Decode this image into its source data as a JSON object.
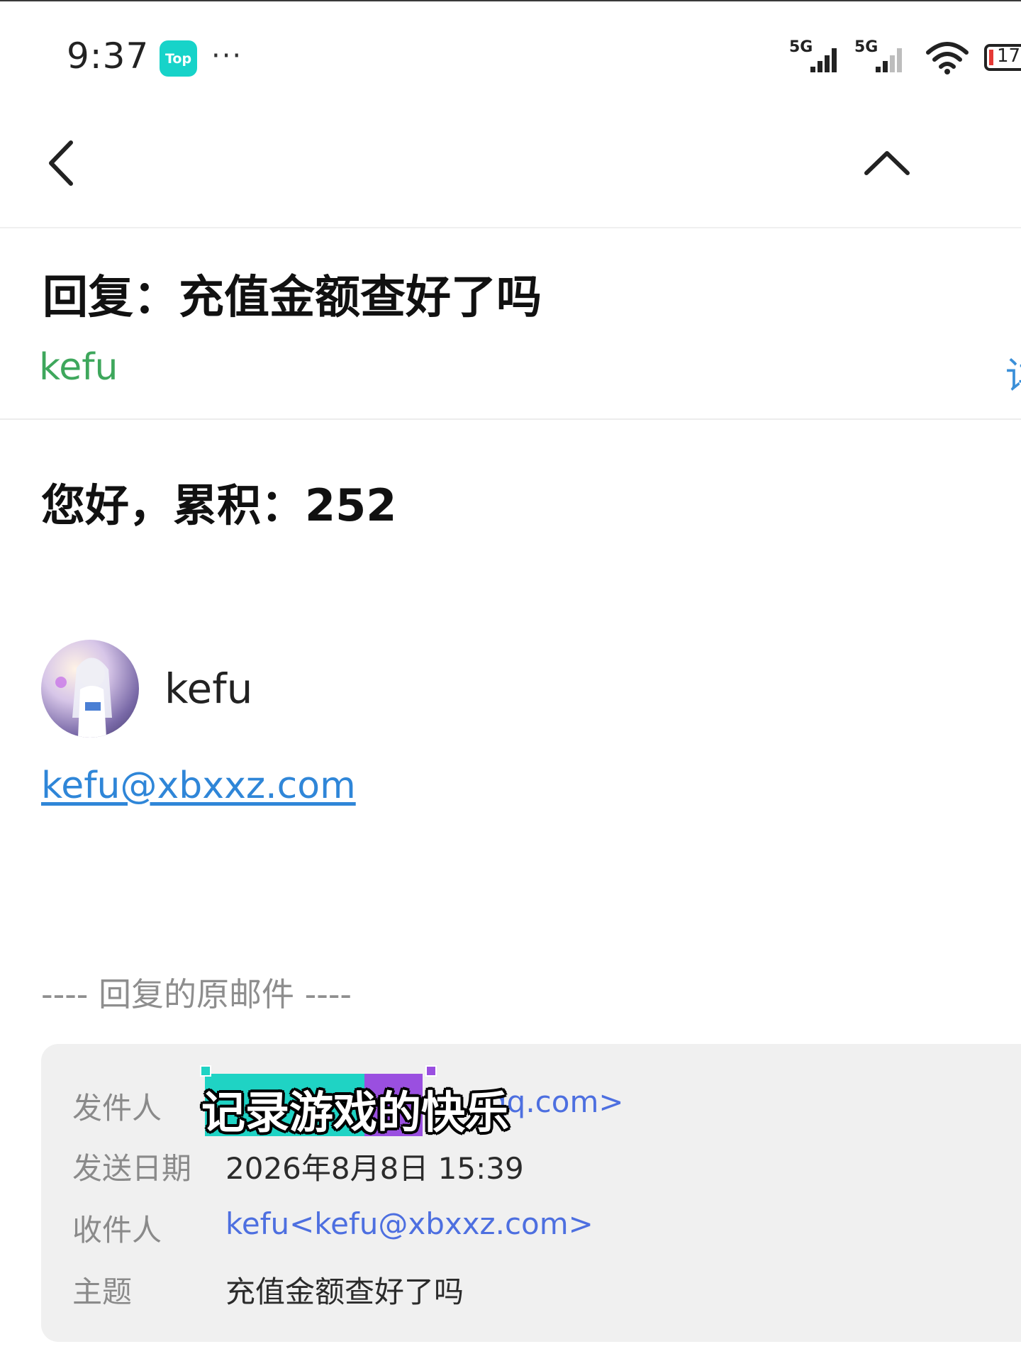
{
  "status_bar": {
    "time": "9:37",
    "app_badge": "Top",
    "more": "···",
    "signal_1": "5G",
    "signal_2": "5G",
    "battery": "17",
    "icons": [
      "signal-icon",
      "wifi-icon",
      "battery-icon"
    ]
  },
  "nav": {
    "back_icon": "chevron-left-icon",
    "up_icon": "chevron-up-icon"
  },
  "email": {
    "subject": "回复：充值金额查好了吗",
    "sender": "kefu",
    "details_link": "详",
    "greeting": "您好，累积：252",
    "signature_name": "kefu",
    "signature_email": "kefu@xbxxz.com",
    "original_separator": "---- 回复的原邮件 ----"
  },
  "original": {
    "from_label": "发件人",
    "from_value_visible": "qq.com>",
    "date_label": "发送日期",
    "date_value": "2026年8月8日 15:39",
    "to_label": "收件人",
    "to_value": "kefu<kefu@xbxxz.com>",
    "subject_label": "主题",
    "subject_value": "充值金额查好了吗"
  },
  "caption": {
    "text": "记录游戏的快乐"
  },
  "colors": {
    "sender_green": "#3ea75c",
    "link_blue": "#2f86d8",
    "meta_link": "#4d6fe0",
    "caption_teal": "#1fd3c4",
    "caption_purple": "#9a4fe0"
  }
}
